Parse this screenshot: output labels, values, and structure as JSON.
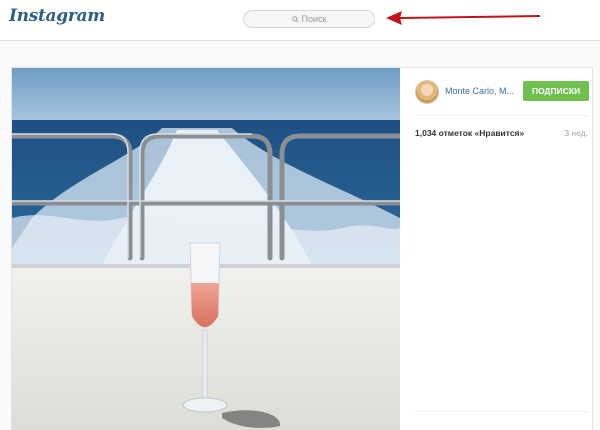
{
  "header": {
    "logo_text": "Instagram",
    "search_placeholder": "Поиск"
  },
  "post": {
    "location": "Monte Carlo, M...",
    "follow_label": "ПОДПИСКИ",
    "likes_text": "1,034 отметок «Нравится»",
    "time_ago": "3 нед."
  },
  "colors": {
    "brand_blue": "#3f729b",
    "follow_green": "#70c050",
    "annotation_arrow": "#c0141b"
  }
}
